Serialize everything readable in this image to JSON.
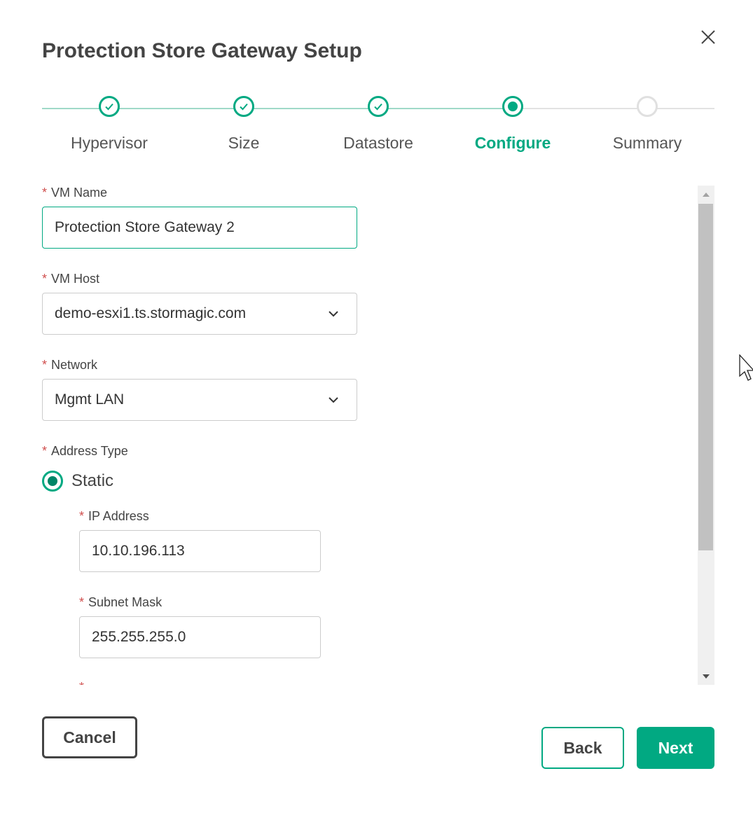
{
  "dialog": {
    "title": "Protection Store Gateway Setup"
  },
  "steps": [
    {
      "label": "Hypervisor",
      "state": "done"
    },
    {
      "label": "Size",
      "state": "done"
    },
    {
      "label": "Datastore",
      "state": "done"
    },
    {
      "label": "Configure",
      "state": "current"
    },
    {
      "label": "Summary",
      "state": "todo"
    }
  ],
  "form": {
    "required_marker": "*",
    "vm_name": {
      "label": "VM Name",
      "value": "Protection Store Gateway 2"
    },
    "vm_host": {
      "label": "VM Host",
      "value": "demo-esxi1.ts.stormagic.com"
    },
    "network": {
      "label": "Network",
      "value": "Mgmt LAN"
    },
    "address_type": {
      "label": "Address Type",
      "option": "Static"
    },
    "ip_address": {
      "label": "IP Address",
      "value": "10.10.196.113"
    },
    "subnet_mask": {
      "label": "Subnet Mask",
      "value": "255.255.255.0"
    }
  },
  "buttons": {
    "cancel": "Cancel",
    "back": "Back",
    "next": "Next"
  },
  "colors": {
    "accent": "#01a982",
    "required": "#d04f4e",
    "text": "#444444"
  }
}
